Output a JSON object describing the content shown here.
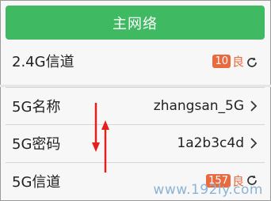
{
  "header": {
    "title": "主网络"
  },
  "rows": [
    {
      "label": "2.4G信道",
      "badge": "10",
      "quality": "良"
    },
    {
      "label": "5G名称",
      "value": "zhangsan_5G"
    },
    {
      "label": "5G密码",
      "value": "1a2b3c4d"
    },
    {
      "label": "5G信道",
      "badge": "157",
      "quality": "良"
    }
  ],
  "watermark": "www.192ly.com",
  "colors": {
    "header_bg": "#3fba63",
    "badge_bg": "#e96a3f",
    "annotation": "#e2201c"
  }
}
